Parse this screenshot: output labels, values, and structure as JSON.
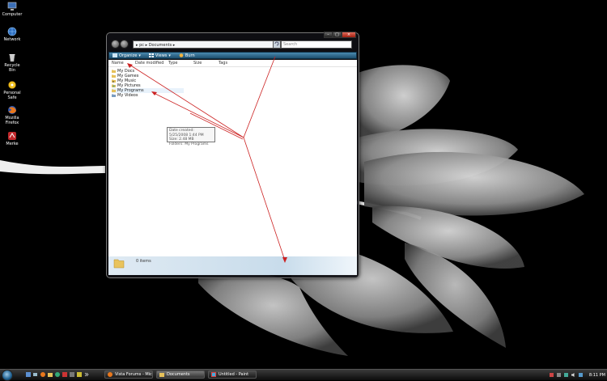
{
  "desktop": {
    "icons": [
      {
        "label": "Computer",
        "icon": "computer-icon"
      },
      {
        "label": "Network",
        "icon": "network-icon"
      },
      {
        "label": "Recycle Bin",
        "icon": "recycle-bin-icon"
      },
      {
        "label": "Personal Safe",
        "icon": "safe-icon"
      },
      {
        "label": "Mozilla\nFirefox",
        "icon": "firefox-icon"
      },
      {
        "label": "Merke",
        "icon": "app-icon"
      }
    ]
  },
  "explorer": {
    "breadcrumb": "▸ pc ▸ Documents ▸",
    "search_placeholder": "Search",
    "toolbar": {
      "organize": "Organize",
      "views": "Views",
      "burn": "Burn"
    },
    "columns": [
      "Name",
      "Date modified",
      "Type",
      "Size",
      "Tags"
    ],
    "items": [
      "My Docs",
      "My Games",
      "My Music",
      "My Pictures",
      "My Programs",
      "My Videos"
    ],
    "tooltip": {
      "line1": "Date created: 5/25/2008 1:44 PM",
      "line2": "Size: 2.48 MB",
      "line3": "Folders: My Programs"
    },
    "status": "0 items"
  },
  "taskbar": {
    "tasks": [
      {
        "label": "Vista Forums - Micr...",
        "icon": "firefox-icon"
      },
      {
        "label": "Documents",
        "icon": "folder-icon"
      },
      {
        "label": "Untitled - Paint",
        "icon": "paint-icon"
      }
    ],
    "clock": "8:11 PM"
  },
  "colors": {
    "arrow": "#cc2222",
    "toolbar": "#2a678c"
  }
}
